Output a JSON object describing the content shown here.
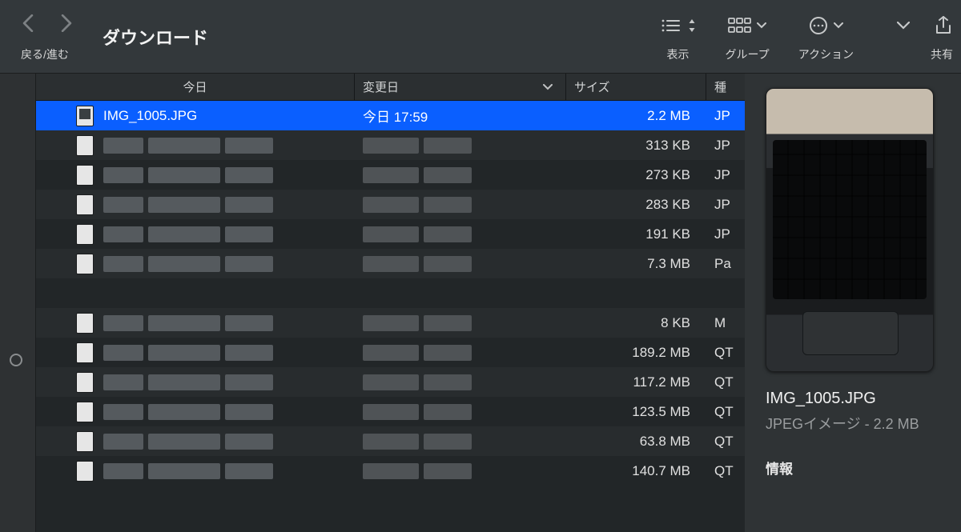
{
  "toolbar": {
    "nav_label": "戻る/進む",
    "title": "ダウンロード",
    "view_label": "表示",
    "group_label": "グループ",
    "action_label": "アクション",
    "share_label": "共有"
  },
  "columns": {
    "name": "今日",
    "date": "変更日",
    "size": "サイズ",
    "kind": "種"
  },
  "rows": [
    {
      "name": "IMG_1005.JPG",
      "date": "今日 17:59",
      "size": "2.2 MB",
      "kind": "JP",
      "selected": true,
      "hidden": false
    },
    {
      "name": "",
      "date": "",
      "size": "313 KB",
      "kind": "JP",
      "selected": false,
      "hidden": true
    },
    {
      "name": "",
      "date": "",
      "size": "273 KB",
      "kind": "JP",
      "selected": false,
      "hidden": true
    },
    {
      "name": "",
      "date": "",
      "size": "283 KB",
      "kind": "JP",
      "selected": false,
      "hidden": true
    },
    {
      "name": "",
      "date": "",
      "size": "191 KB",
      "kind": "JP",
      "selected": false,
      "hidden": true
    },
    {
      "name": "",
      "date": "",
      "size": "7.3 MB",
      "kind": "Pa",
      "selected": false,
      "hidden": true
    },
    {
      "name": "",
      "date": "",
      "size": "",
      "kind": "",
      "selected": false,
      "hidden": true,
      "empty": true
    },
    {
      "name": "",
      "date": "",
      "size": "8 KB",
      "kind": "M",
      "selected": false,
      "hidden": true
    },
    {
      "name": "",
      "date": "",
      "size": "189.2 MB",
      "kind": "QT",
      "selected": false,
      "hidden": true
    },
    {
      "name": "",
      "date": "",
      "size": "117.2 MB",
      "kind": "QT",
      "selected": false,
      "hidden": true
    },
    {
      "name": "",
      "date": "",
      "size": "123.5 MB",
      "kind": "QT",
      "selected": false,
      "hidden": true
    },
    {
      "name": "",
      "date": "",
      "size": "63.8 MB",
      "kind": "QT",
      "selected": false,
      "hidden": true
    },
    {
      "name": "",
      "date": "",
      "size": "140.7 MB",
      "kind": "QT",
      "selected": false,
      "hidden": true
    }
  ],
  "preview": {
    "name": "IMG_1005.JPG",
    "subtitle": "JPEGイメージ - 2.2 MB",
    "section": "情報"
  }
}
